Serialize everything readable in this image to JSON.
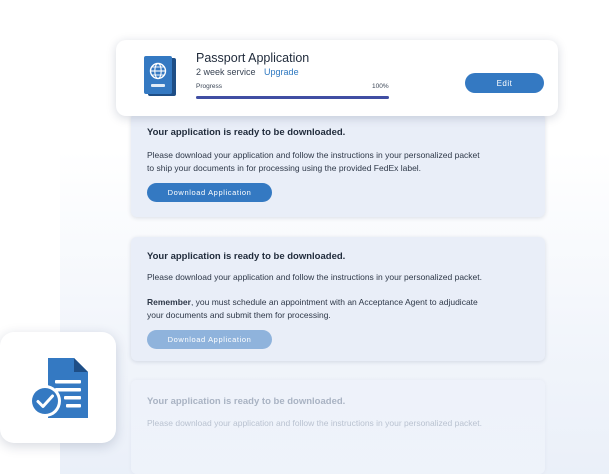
{
  "header": {
    "title": "Passport Application",
    "service": "2 week service",
    "upgrade_label": "Upgrade",
    "progress_label": "Progress",
    "progress_text": "100%",
    "progress_percent": 100,
    "edit_label": "Edit",
    "icon": "passport-icon"
  },
  "cards": [
    {
      "heading": "Your application is ready to be downloaded.",
      "body_line1": "Please download your application and follow the instructions in your personalized packet",
      "body_line2": "to ship your documents in for processing using the provided FedEx label.",
      "button_label": "Download Application"
    },
    {
      "heading": "Your application is ready to be downloaded.",
      "body_line1": "Please download your application and follow the instructions in your personalized packet.",
      "remember_bold": "Remember",
      "remember_rest": ", you must schedule an appointment with an Acceptance Agent to adjudicate",
      "remember_line2": "your documents and submit them for processing.",
      "button_label": "Download Application"
    },
    {
      "heading": "Your application is ready to be downloaded.",
      "body_line1": "Please download your application and follow the instructions in your personalized packet."
    }
  ],
  "doc_icon": "document-check-icon",
  "colors": {
    "accent": "#3479c2",
    "progress": "#404ea3",
    "card_bg": "#e9eef8",
    "disabled_button": "#8fb3dc"
  }
}
